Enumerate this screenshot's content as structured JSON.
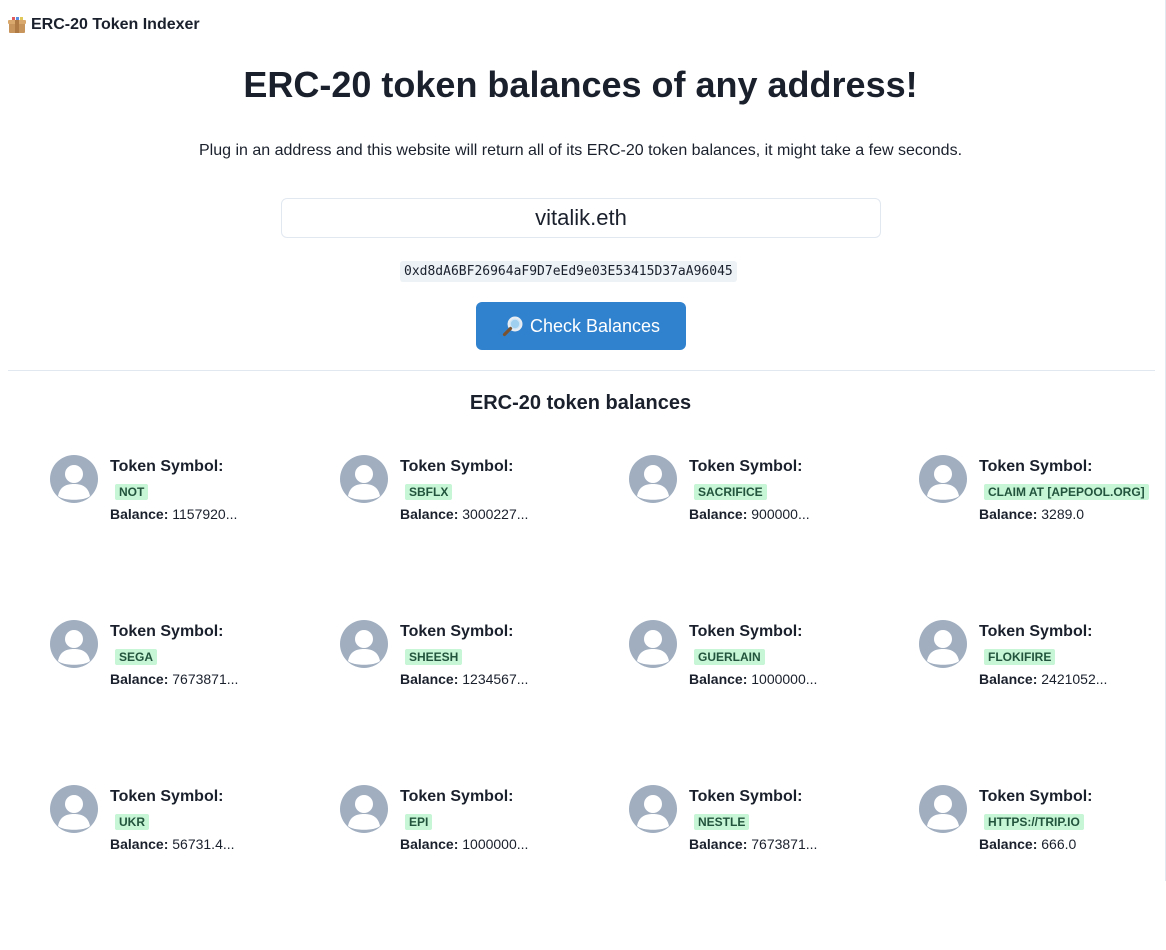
{
  "app": {
    "brand_emoji": "package-icon",
    "brand_title": "ERC-20 Token Indexer"
  },
  "hero": {
    "title": "ERC-20 token balances of any address!",
    "subtitle": "Plug in an address and this website will return all of its ERC-20 token balances, it might take a few seconds."
  },
  "search": {
    "value": "vitalik.eth",
    "resolved_address": "0xd8dA6BF26964aF9D7eEd9e03E53415D37aA96045",
    "button_label": "Check Balances",
    "button_icon": "magnifying-glass-icon"
  },
  "results": {
    "heading": "ERC-20 token balances",
    "symbol_label": "Token Symbol:",
    "balance_label": "Balance:",
    "tokens": [
      {
        "symbol": "NOT",
        "balance": "1157920..."
      },
      {
        "symbol": "SBFLX",
        "balance": "3000227..."
      },
      {
        "symbol": "SACRIFICE",
        "balance": "900000..."
      },
      {
        "symbol": "CLAIM AT [APEPOOL.ORG]",
        "balance": "3289.0"
      },
      {
        "symbol": "SEGA",
        "balance": "7673871..."
      },
      {
        "symbol": "SHEESH",
        "balance": "1234567..."
      },
      {
        "symbol": "GUERLAIN",
        "balance": "1000000..."
      },
      {
        "symbol": "FLOKIFIRE",
        "balance": "2421052..."
      },
      {
        "symbol": "UKR",
        "balance": "56731.4..."
      },
      {
        "symbol": "EPI",
        "balance": "1000000..."
      },
      {
        "symbol": "NESTLE",
        "balance": "7673871..."
      },
      {
        "symbol": "HTTPS://TRIP.IO",
        "balance": "666.0"
      }
    ]
  },
  "colors": {
    "accent": "#3182ce",
    "badge_bg": "#c6f6d5",
    "badge_text": "#22543d",
    "avatar": "#a0aec0"
  }
}
